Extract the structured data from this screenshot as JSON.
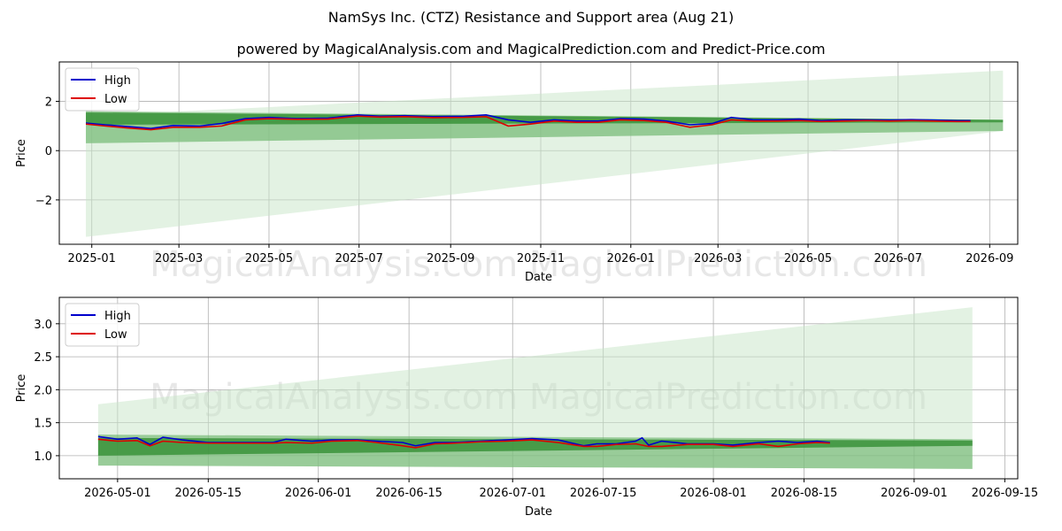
{
  "title": "NamSys Inc. (CTZ) Resistance and Support area (Aug 21)",
  "subtitle": "powered by MagicalAnalysis.com and MagicalPrediction.com and Predict-Price.com",
  "watermark": "MagicalAnalysis.com    MagicalPrediction.com",
  "colors": {
    "high": "#0000cc",
    "low": "#dd0000",
    "band_dark": "#2e8b2e",
    "band_light": "#7fbf7f",
    "cone": "#c8e6c8"
  },
  "chart_data": [
    {
      "type": "line",
      "xlabel": "Date",
      "ylabel": "Price",
      "grid": true,
      "legend": "top-left",
      "xlim": [
        "2024-12-10",
        "2026-09-20"
      ],
      "ylim": [
        -3.8,
        3.6
      ],
      "xticks": [
        "2025-01",
        "2025-03",
        "2025-05",
        "2025-07",
        "2025-09",
        "2025-11",
        "2026-01",
        "2026-03",
        "2026-05",
        "2026-07",
        "2026-09"
      ],
      "yticks": [
        -2,
        0,
        2
      ],
      "series": [
        {
          "name": "High",
          "x": [
            "2024-12-28",
            "2025-01-10",
            "2025-01-25",
            "2025-02-10",
            "2025-02-25",
            "2025-03-15",
            "2025-03-30",
            "2025-04-15",
            "2025-05-01",
            "2025-05-20",
            "2025-06-10",
            "2025-06-30",
            "2025-07-15",
            "2025-08-01",
            "2025-08-20",
            "2025-09-10",
            "2025-09-25",
            "2025-10-10",
            "2025-10-25",
            "2025-11-10",
            "2025-11-25",
            "2025-12-10",
            "2025-12-25",
            "2026-01-10",
            "2026-01-25",
            "2026-02-10",
            "2026-02-25",
            "2026-03-10",
            "2026-03-25",
            "2026-04-10",
            "2026-04-25",
            "2026-05-10",
            "2026-05-25",
            "2026-06-10",
            "2026-06-25",
            "2026-07-10",
            "2026-07-25",
            "2026-08-10",
            "2026-08-19"
          ],
          "values": [
            1.12,
            1.05,
            0.98,
            0.9,
            1.02,
            1.0,
            1.1,
            1.3,
            1.35,
            1.3,
            1.32,
            1.45,
            1.4,
            1.42,
            1.38,
            1.4,
            1.45,
            1.25,
            1.15,
            1.25,
            1.2,
            1.2,
            1.3,
            1.28,
            1.2,
            1.05,
            1.1,
            1.35,
            1.25,
            1.25,
            1.28,
            1.22,
            1.25,
            1.25,
            1.24,
            1.26,
            1.24,
            1.22,
            1.22
          ]
        },
        {
          "name": "Low",
          "x": [
            "2024-12-28",
            "2025-01-10",
            "2025-01-25",
            "2025-02-10",
            "2025-02-25",
            "2025-03-15",
            "2025-03-30",
            "2025-04-15",
            "2025-05-01",
            "2025-05-20",
            "2025-06-10",
            "2025-06-30",
            "2025-07-15",
            "2025-08-01",
            "2025-08-20",
            "2025-09-10",
            "2025-09-25",
            "2025-10-10",
            "2025-10-25",
            "2025-11-10",
            "2025-11-25",
            "2025-12-10",
            "2025-12-25",
            "2026-01-10",
            "2026-01-25",
            "2026-02-10",
            "2026-02-25",
            "2026-03-10",
            "2026-03-25",
            "2026-04-10",
            "2026-04-25",
            "2026-05-10",
            "2026-05-25",
            "2026-06-10",
            "2026-06-25",
            "2026-07-10",
            "2026-07-25",
            "2026-08-10",
            "2026-08-19"
          ],
          "values": [
            1.08,
            1.0,
            0.92,
            0.85,
            0.95,
            0.95,
            1.0,
            1.25,
            1.3,
            1.27,
            1.28,
            1.4,
            1.36,
            1.38,
            1.34,
            1.35,
            1.38,
            1.0,
            1.08,
            1.2,
            1.15,
            1.15,
            1.25,
            1.22,
            1.15,
            0.95,
            1.05,
            1.25,
            1.2,
            1.2,
            1.22,
            1.18,
            1.2,
            1.22,
            1.2,
            1.22,
            1.2,
            1.18,
            1.18
          ]
        }
      ],
      "support_band": {
        "x": [
          "2024-12-28",
          "2026-09-10"
        ],
        "upper": [
          1.55,
          1.25
        ],
        "lower": [
          1.05,
          1.15
        ],
        "outer_upper": [
          1.6,
          1.25
        ],
        "outer_lower": [
          0.3,
          0.8
        ]
      },
      "cone": {
        "x": [
          "2024-12-28",
          "2026-09-10"
        ],
        "upper": [
          1.4,
          3.25
        ],
        "lower": [
          -3.5,
          0.8
        ]
      }
    },
    {
      "type": "line",
      "xlabel": "Date",
      "ylabel": "Price",
      "grid": true,
      "legend": "top-left",
      "xlim": [
        "2026-04-22",
        "2026-09-17"
      ],
      "ylim": [
        0.65,
        3.4
      ],
      "xticks": [
        "2026-05-01",
        "2026-05-15",
        "2026-06-01",
        "2026-06-15",
        "2026-07-01",
        "2026-07-15",
        "2026-08-01",
        "2026-08-15",
        "2026-09-01",
        "2026-09-15"
      ],
      "yticks": [
        1.0,
        1.5,
        2.0,
        2.5,
        3.0
      ],
      "series": [
        {
          "name": "High",
          "x": [
            "2026-04-28",
            "2026-05-01",
            "2026-05-04",
            "2026-05-06",
            "2026-05-08",
            "2026-05-11",
            "2026-05-15",
            "2026-05-20",
            "2026-05-25",
            "2026-05-27",
            "2026-05-31",
            "2026-06-03",
            "2026-06-07",
            "2026-06-10",
            "2026-06-14",
            "2026-06-16",
            "2026-06-19",
            "2026-06-22",
            "2026-06-26",
            "2026-06-30",
            "2026-07-04",
            "2026-07-08",
            "2026-07-12",
            "2026-07-14",
            "2026-07-17",
            "2026-07-20",
            "2026-07-21",
            "2026-07-22",
            "2026-07-24",
            "2026-07-28",
            "2026-08-01",
            "2026-08-04",
            "2026-08-08",
            "2026-08-11",
            "2026-08-14",
            "2026-08-17",
            "2026-08-19"
          ],
          "values": [
            1.29,
            1.25,
            1.27,
            1.17,
            1.28,
            1.24,
            1.2,
            1.2,
            1.2,
            1.25,
            1.22,
            1.24,
            1.24,
            1.22,
            1.2,
            1.15,
            1.2,
            1.2,
            1.22,
            1.24,
            1.26,
            1.24,
            1.15,
            1.18,
            1.18,
            1.22,
            1.27,
            1.16,
            1.22,
            1.18,
            1.18,
            1.16,
            1.2,
            1.22,
            1.2,
            1.22,
            1.2
          ]
        },
        {
          "name": "Low",
          "x": [
            "2026-04-28",
            "2026-05-01",
            "2026-05-04",
            "2026-05-06",
            "2026-05-08",
            "2026-05-11",
            "2026-05-15",
            "2026-05-20",
            "2026-05-25",
            "2026-05-27",
            "2026-05-31",
            "2026-06-03",
            "2026-06-07",
            "2026-06-10",
            "2026-06-14",
            "2026-06-16",
            "2026-06-19",
            "2026-06-22",
            "2026-06-26",
            "2026-06-30",
            "2026-07-04",
            "2026-07-08",
            "2026-07-12",
            "2026-07-14",
            "2026-07-17",
            "2026-07-20",
            "2026-07-21",
            "2026-07-22",
            "2026-07-24",
            "2026-07-28",
            "2026-08-01",
            "2026-08-04",
            "2026-08-08",
            "2026-08-11",
            "2026-08-14",
            "2026-08-17",
            "2026-08-19"
          ],
          "values": [
            1.25,
            1.22,
            1.23,
            1.15,
            1.22,
            1.2,
            1.19,
            1.19,
            1.19,
            1.2,
            1.19,
            1.22,
            1.23,
            1.2,
            1.15,
            1.12,
            1.18,
            1.19,
            1.21,
            1.22,
            1.24,
            1.2,
            1.14,
            1.14,
            1.17,
            1.18,
            1.16,
            1.14,
            1.14,
            1.17,
            1.17,
            1.14,
            1.18,
            1.14,
            1.18,
            1.2,
            1.19
          ]
        }
      ],
      "support_band": {
        "x": [
          "2026-04-28",
          "2026-09-10"
        ],
        "upper": [
          1.27,
          1.23
        ],
        "lower": [
          1.0,
          1.15
        ],
        "outer_upper": [
          1.32,
          1.25
        ],
        "outer_lower": [
          0.85,
          0.8
        ]
      },
      "cone": {
        "x": [
          "2026-04-28",
          "2026-09-10"
        ],
        "upper": [
          1.78,
          3.25
        ],
        "lower": [
          1.32,
          1.25
        ]
      }
    }
  ]
}
